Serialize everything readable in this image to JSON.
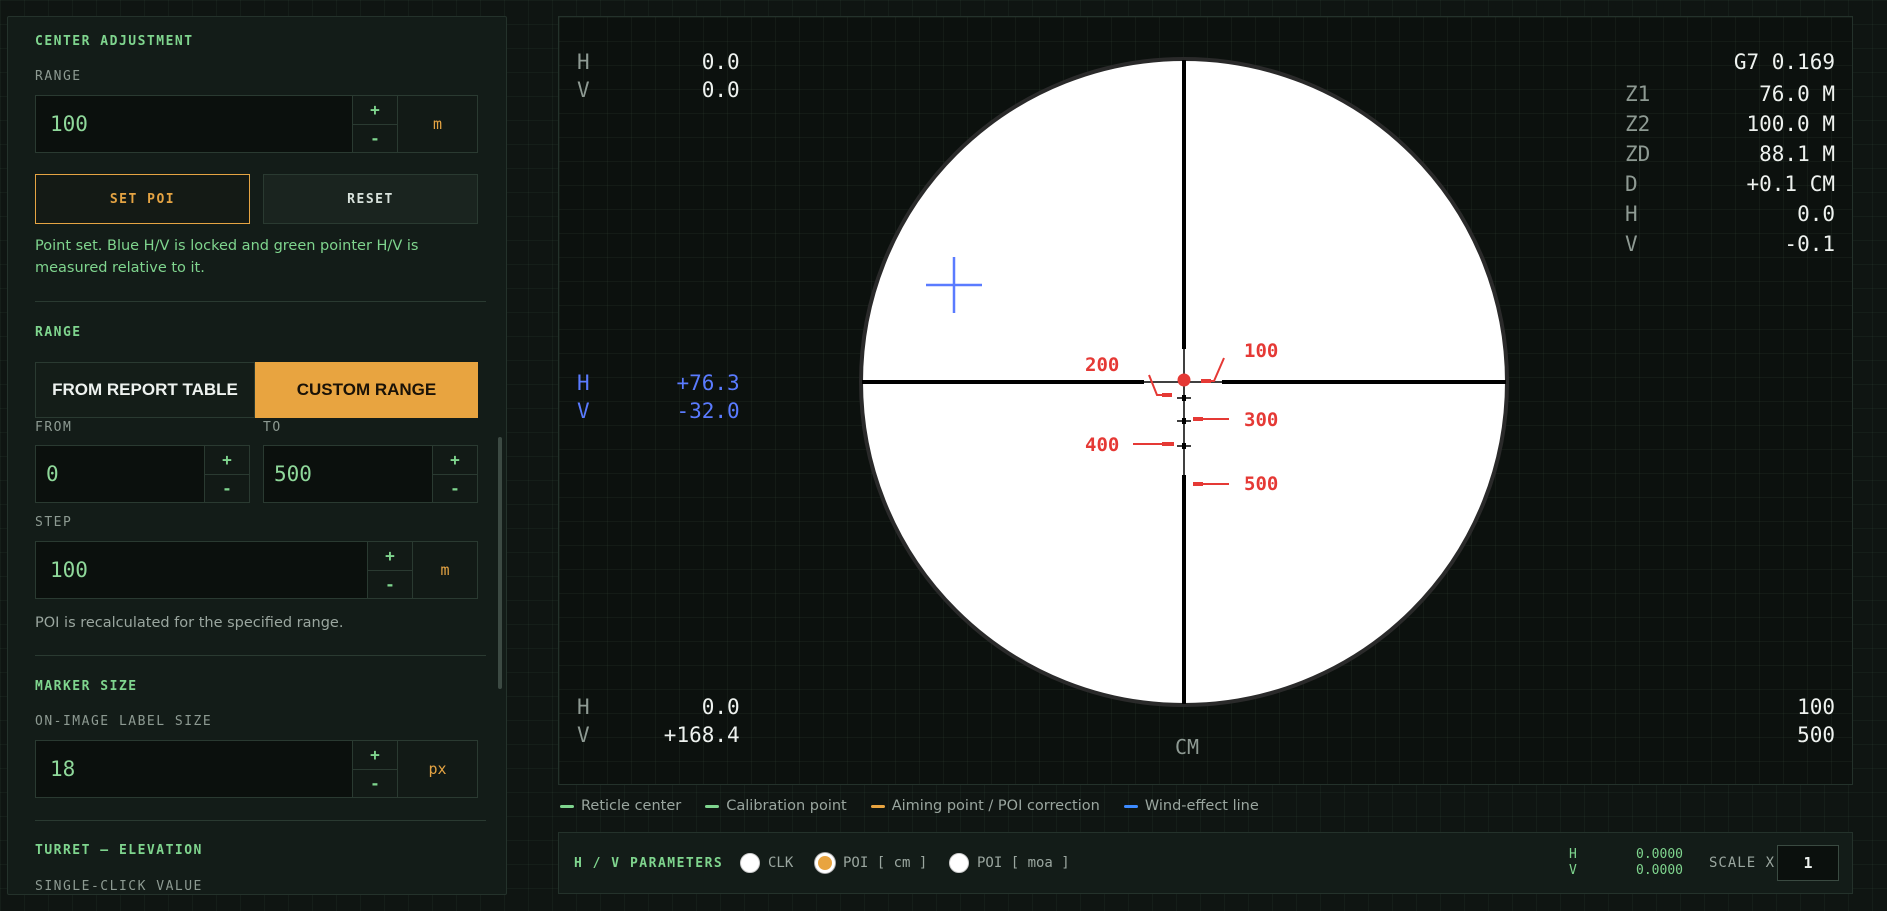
{
  "sidebar": {
    "center_adjustment": {
      "title": "CENTER ADJUSTMENT",
      "range_label": "RANGE",
      "range_value": "100",
      "range_unit": "m",
      "set_poi": "SET POI",
      "reset": "RESET",
      "note": "Point set. Blue H/V is locked and green pointer H/V is measured relative to it."
    },
    "range": {
      "title": "RANGE",
      "tab_report": "FROM REPORT TABLE",
      "tab_custom": "CUSTOM RANGE",
      "from_label": "FROM",
      "from_value": "0",
      "to_label": "TO",
      "to_value": "500",
      "step_label": "STEP",
      "step_value": "100",
      "step_unit": "m",
      "note": "POI is recalculated for the specified range."
    },
    "marker_size": {
      "title": "MARKER SIZE",
      "label": "ON-IMAGE LABEL SIZE",
      "value": "18",
      "unit": "px"
    },
    "turret": {
      "title": "TURRET — ELEVATION",
      "label": "SINGLE-CLICK VALUE"
    },
    "plus": "+",
    "minus": "-"
  },
  "viewer": {
    "top_left": {
      "h_key": "H",
      "h_val": "0.0",
      "v_key": "V",
      "v_val": "0.0"
    },
    "top_right": {
      "bullet": "G7 0.169",
      "rows": [
        {
          "k": "Z1",
          "v": "76.0 M"
        },
        {
          "k": "Z2",
          "v": "100.0 M"
        },
        {
          "k": "ZD",
          "v": "88.1 M"
        },
        {
          "k": "D",
          "v": "+0.1 CM"
        },
        {
          "k": "H",
          "v": "0.0"
        },
        {
          "k": "V",
          "v": "-0.1"
        }
      ]
    },
    "wind": {
      "h_key": "H",
      "h_val": "+76.3",
      "v_key": "V",
      "v_val": "-32.0"
    },
    "bottom_left": {
      "h_key": "H",
      "h_val": "0.0",
      "v_key": "V",
      "v_val": "+168.4"
    },
    "bottom_right": {
      "a": "100",
      "b": "500"
    },
    "unit_caption": "CM",
    "markers": [
      "100",
      "200",
      "300",
      "400",
      "500"
    ]
  },
  "legend": {
    "items": [
      {
        "label": "Reticle center",
        "color": "#7fd58e"
      },
      {
        "label": "Calibration point",
        "color": "#7fd58e"
      },
      {
        "label": "Aiming point / POI correction",
        "color": "#e8a440"
      },
      {
        "label": "Wind-effect line",
        "color": "#3d8bff"
      }
    ]
  },
  "bottombar": {
    "title": "H / V PARAMETERS",
    "radio_clk": "CLK",
    "radio_poi_cm": "POI [ cm ]",
    "radio_poi_moa": "POI [ moa ]",
    "h_key": "H",
    "h_val": "0.0000",
    "v_key": "V",
    "v_val": "0.0000",
    "scale_label": "SCALE X",
    "scale_value": "1"
  },
  "colors": {
    "accent": "#e8a440",
    "green": "#7fd58e",
    "marker_red": "#e53935",
    "wind_blue": "#5a7bff"
  }
}
